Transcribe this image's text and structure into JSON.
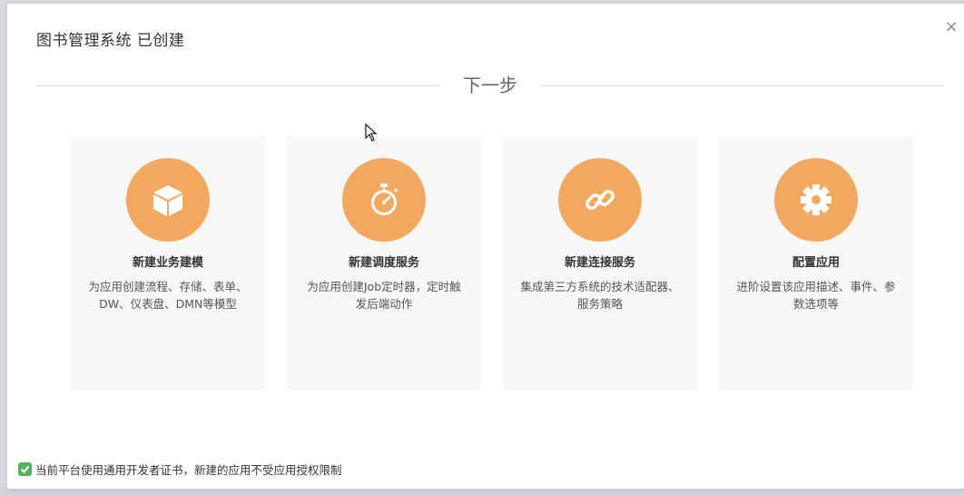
{
  "dialog": {
    "title": "图书管理系统 已创建",
    "close_label": "×"
  },
  "section": {
    "heading": "下一步"
  },
  "cards": [
    {
      "title": "新建业务建模",
      "description": "为应用创建流程、存储、表单、DW、仪表盘、DMN等模型",
      "icon": "cube-icon"
    },
    {
      "title": "新建调度服务",
      "description": "为应用创建Job定时器，定时触发后端动作",
      "icon": "stopwatch-icon"
    },
    {
      "title": "新建连接服务",
      "description": "集成第三方系统的技术适配器、服务策略",
      "icon": "link-icon"
    },
    {
      "title": "配置应用",
      "description": "进阶设置该应用描述、事件、参数选项等",
      "icon": "gear-icon"
    }
  ],
  "notice": {
    "text": "当前平台使用通用开发者证书，新建的应用不受应用授权限制",
    "icon": "check-icon"
  },
  "colors": {
    "accent": "#f2a85e",
    "card_bg": "#f7f7f7",
    "check_green": "#52b35a"
  }
}
